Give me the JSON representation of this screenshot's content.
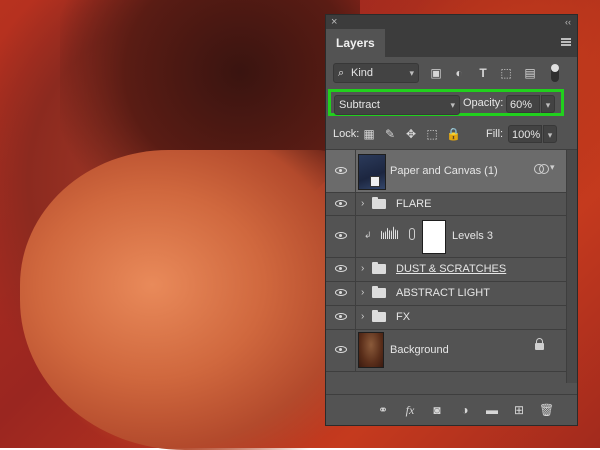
{
  "panel": {
    "title": "Layers",
    "close_glyph": "×",
    "collapse_glyph": "‹‹"
  },
  "filter": {
    "kind_label": "Kind",
    "icons": [
      "image-filter-icon",
      "adjustment-filter-icon",
      "type-filter-icon",
      "shape-filter-icon",
      "smart-object-filter-icon"
    ]
  },
  "blend": {
    "mode": "Subtract",
    "opacity_label": "Opacity:",
    "opacity_value": "60%",
    "highlight_color": "#21d01d"
  },
  "lock": {
    "label": "Lock:",
    "fill_label": "Fill:",
    "fill_value": "100%"
  },
  "layers": [
    {
      "name": "Paper and Canvas (1)",
      "type": "smart-object",
      "selected": true
    },
    {
      "name": "FLARE",
      "type": "group"
    },
    {
      "name": "Levels 3",
      "type": "adjustment"
    },
    {
      "name": "DUST & SCRATCHES",
      "type": "group"
    },
    {
      "name": "ABSTRACT LIGHT",
      "type": "group"
    },
    {
      "name": "FX",
      "type": "group"
    },
    {
      "name": "Background",
      "type": "image",
      "locked": true
    }
  ],
  "bottom_icons": [
    "link-layers-icon",
    "fx-icon",
    "add-mask-icon",
    "adjustment-layer-icon",
    "new-group-icon",
    "new-layer-icon",
    "delete-layer-icon"
  ]
}
